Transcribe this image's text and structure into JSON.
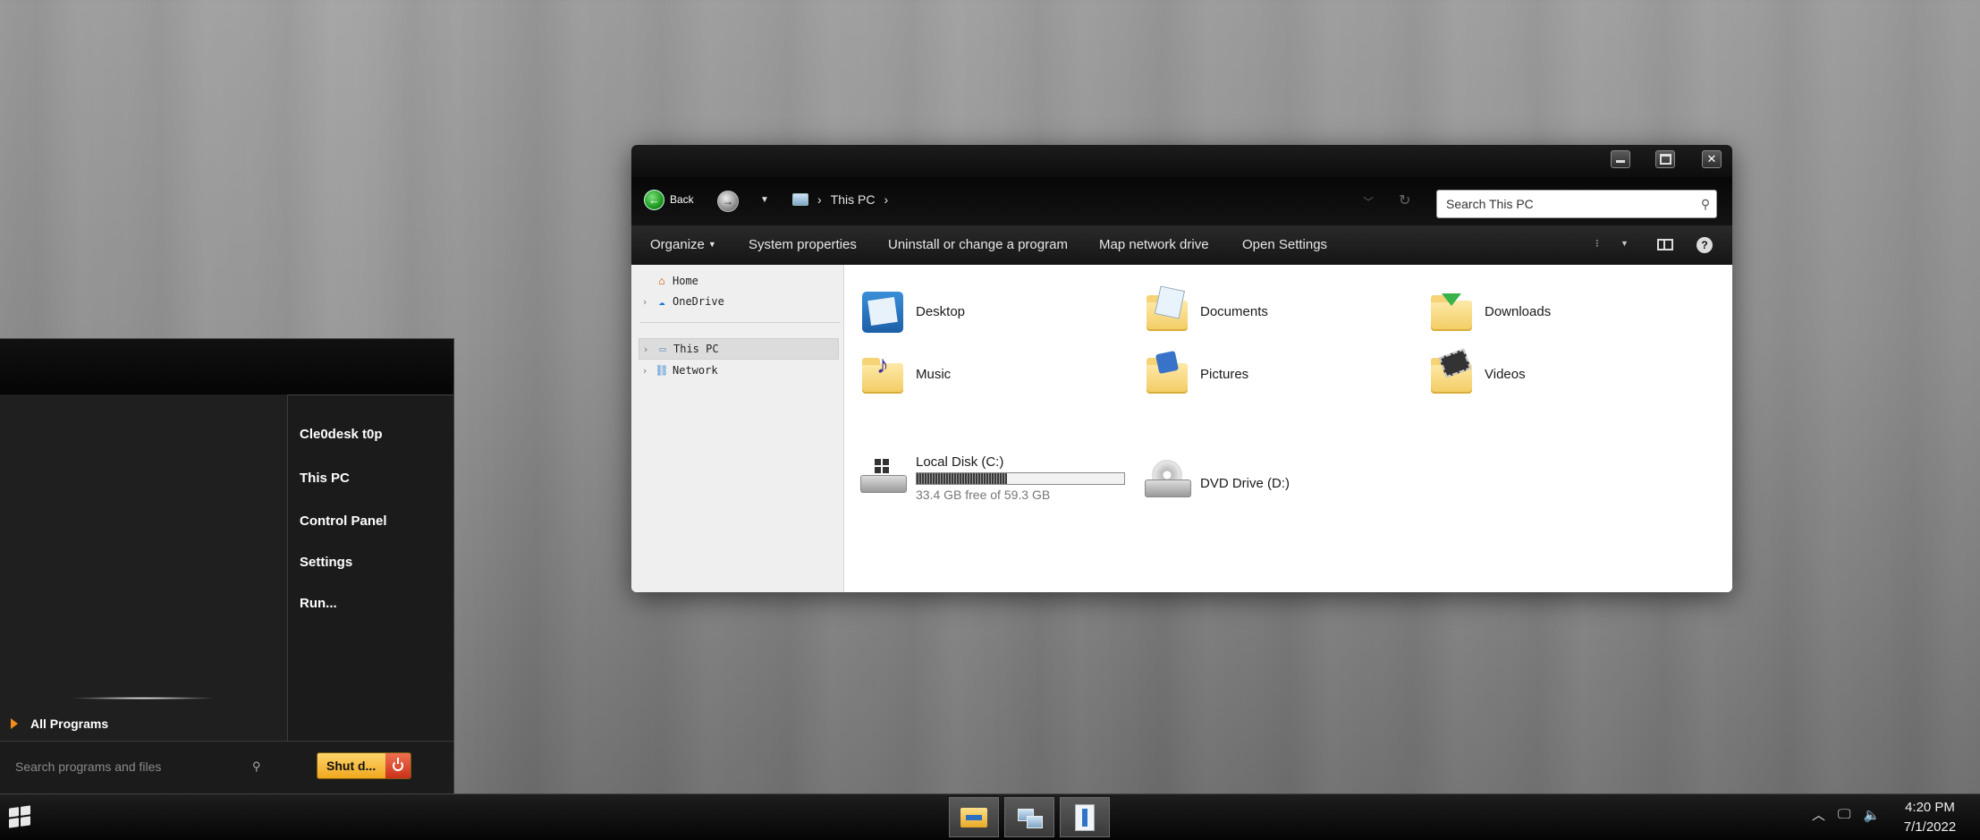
{
  "explorer": {
    "back_label": "Back",
    "breadcrumb": [
      "This PC"
    ],
    "search_placeholder": "Search This PC",
    "commands": [
      "Organize",
      "System properties",
      "Uninstall or change a program",
      "Map network drive",
      "Open Settings"
    ],
    "nav_items": [
      {
        "label": "Home",
        "icon": "home-icon"
      },
      {
        "label": "OneDrive",
        "icon": "cloud-icon"
      },
      {
        "label": "This PC",
        "icon": "computer-icon"
      },
      {
        "label": "Network",
        "icon": "network-icon"
      }
    ],
    "folders": [
      "Desktop",
      "Documents",
      "Downloads",
      "Music",
      "Pictures",
      "Videos"
    ],
    "drives": [
      {
        "name": "Local Disk (C:)",
        "free_text": "33.4 GB free of 59.3 GB",
        "used_fraction": 0.437
      },
      {
        "name": "DVD Drive (D:)"
      }
    ]
  },
  "start_menu": {
    "right_items": [
      "Cle0desk t0p",
      "This PC",
      "Control Panel",
      "Settings",
      "Run..."
    ],
    "all_programs": "All Programs",
    "search_placeholder": "Search programs and files",
    "shutdown_label": "Shut d..."
  },
  "taskbar": {
    "time": "4:20 PM",
    "date": "7/1/2022"
  },
  "colors": {
    "accent_orange": "#f28c1b",
    "shutdown_yellow": "#f0a81f",
    "disk_bar": "#3a3a3a"
  }
}
